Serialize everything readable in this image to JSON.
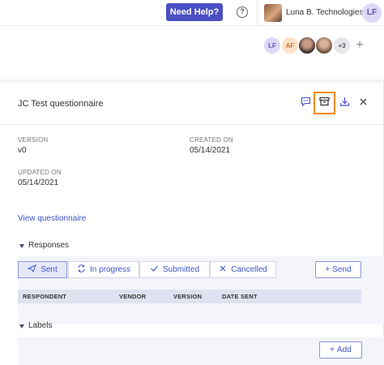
{
  "topbar": {
    "help_label": "Need Help?",
    "help_icon": "?",
    "org_name": "Luna B. Technologies",
    "user_initials": "LF"
  },
  "collaborators": {
    "items": [
      {
        "initials": "LF",
        "color": "#5a52b8"
      },
      {
        "initials": "AF",
        "color": "#c2763a"
      },
      {
        "initials": ""
      },
      {
        "initials": ""
      },
      {
        "initials": "+3"
      }
    ],
    "add_icon": "+"
  },
  "panel": {
    "title": "JC Test questionnaire",
    "icons": {
      "comment": "comment-icon",
      "archive": "archive-icon",
      "download": "download-icon",
      "close": "close-icon"
    },
    "meta": {
      "version_label": "VERSION",
      "version_value": "v0",
      "created_label": "CREATED ON",
      "created_value": "05/14/2021",
      "updated_label": "UPDATED ON",
      "updated_value": "05/14/2021"
    },
    "view_link": "View questionnaire"
  },
  "responses": {
    "title": "Responses",
    "tabs": [
      {
        "label": "Sent",
        "icon": "send-icon",
        "active": true
      },
      {
        "label": "In progress",
        "icon": "refresh-icon",
        "active": false
      },
      {
        "label": "Submitted",
        "icon": "check-icon",
        "active": false
      },
      {
        "label": "Cancelled",
        "icon": "x-icon",
        "active": false
      }
    ],
    "send_label": "Send",
    "columns": [
      "RESPONDENT",
      "VENDOR",
      "VERSION",
      "DATE SENT"
    ]
  },
  "labels": {
    "title": "Labels",
    "add_label": "Add"
  },
  "colors": {
    "accent": "#4b4fc3",
    "link": "#3e54c8",
    "highlight": "#f08a1c"
  }
}
